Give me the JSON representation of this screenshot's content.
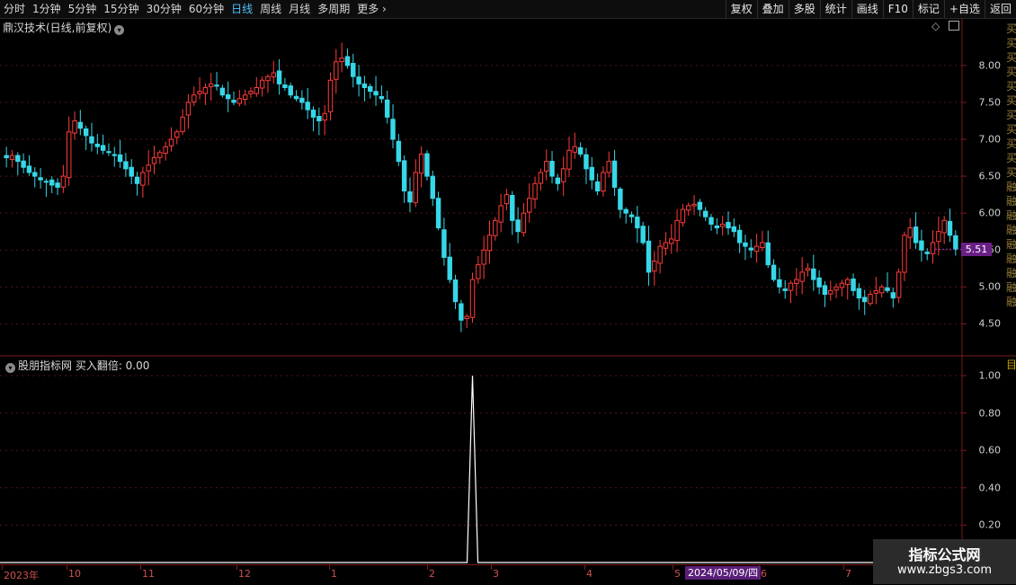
{
  "toolbar": {
    "periods": [
      {
        "label": "分时",
        "active": false
      },
      {
        "label": "1分钟",
        "active": false
      },
      {
        "label": "5分钟",
        "active": false
      },
      {
        "label": "15分钟",
        "active": false
      },
      {
        "label": "30分钟",
        "active": false
      },
      {
        "label": "60分钟",
        "active": false
      },
      {
        "label": "日线",
        "active": true
      },
      {
        "label": "周线",
        "active": false
      },
      {
        "label": "月线",
        "active": false
      },
      {
        "label": "多周期",
        "active": false
      }
    ],
    "more_label": "更多",
    "right_buttons": [
      "复权",
      "叠加",
      "多股",
      "统计",
      "画线",
      "F10",
      "标记",
      "+自选",
      "返回"
    ]
  },
  "main_panel": {
    "title": "鼎汉技术(日线,前复权)",
    "price_axis": [
      "8.00",
      "7.50",
      "7.00",
      "6.50",
      "6.00",
      "5.50",
      "5.00",
      "4.50"
    ],
    "current_price": "5.51"
  },
  "indicator_panel": {
    "title": "股朋指标网 买入翻倍: 0.00",
    "axis": [
      "1.00",
      "0.80",
      "0.60",
      "0.40",
      "0.20"
    ],
    "side_label": "目"
  },
  "side_strip_text": "买买买买买买买买买买买融融融融融融融融融",
  "date_axis": {
    "labels": [
      "2023年",
      "10",
      "11",
      "12",
      "1",
      "2",
      "3",
      "4",
      "5",
      "6",
      "7"
    ],
    "cursor_date": "2024/05/09/四"
  },
  "watermark": {
    "title": "指标公式网",
    "url": "www.zbgs3.com"
  },
  "chart_data": [
    {
      "type": "candlestick",
      "title": "鼎汉技术(日线,前复权)",
      "ylim": [
        4.2,
        8.4
      ],
      "up_color": "#ff3b3b",
      "down_color": "#36d8e8",
      "series": [
        {
          "values": [
            6.75,
            6.78,
            6.7,
            6.62,
            6.55,
            6.5,
            6.45,
            6.42,
            6.38,
            6.35,
            6.5,
            7.1,
            7.25,
            7.15,
            7.05,
            6.95,
            6.9,
            6.85,
            6.82,
            6.78,
            6.7,
            6.6,
            6.5,
            6.4,
            6.55,
            6.65,
            6.75,
            6.82,
            6.9,
            7.0,
            7.1,
            7.3,
            7.5,
            7.6,
            7.65,
            7.7,
            7.75,
            7.72,
            7.6,
            7.55,
            7.5,
            7.55,
            7.6,
            7.65,
            7.7,
            7.8,
            7.85,
            7.9,
            7.75,
            7.7,
            7.6,
            7.55,
            7.5,
            7.4,
            7.3,
            7.25,
            7.35,
            7.8,
            8.05,
            8.1,
            8.0,
            7.85,
            7.75,
            7.7,
            7.65,
            7.6,
            7.55,
            7.3,
            7.0,
            6.7,
            6.3,
            6.15,
            6.55,
            6.8,
            6.5,
            6.2,
            5.8,
            5.4,
            5.1,
            4.8,
            4.55,
            4.6,
            5.1,
            5.3,
            5.5,
            5.7,
            5.9,
            6.1,
            6.25,
            5.9,
            5.75,
            6.0,
            6.2,
            6.4,
            6.55,
            6.7,
            6.5,
            6.4,
            6.6,
            6.85,
            6.9,
            6.8,
            6.6,
            6.45,
            6.3,
            6.55,
            6.7,
            6.35,
            6.05,
            6.0,
            5.95,
            5.8,
            5.6,
            5.2,
            5.35,
            5.55,
            5.6,
            5.65,
            5.9,
            6.05,
            6.1,
            6.12,
            6.05,
            5.95,
            5.85,
            5.8,
            5.85,
            5.8,
            5.75,
            5.6,
            5.55,
            5.5,
            5.55,
            5.6,
            5.3,
            5.1,
            5.0,
            4.95,
            5.05,
            5.1,
            5.2,
            5.25,
            5.1,
            5.0,
            4.9,
            4.95,
            5.0,
            5.05,
            5.1,
            4.95,
            4.85,
            4.8,
            4.9,
            4.95,
            5.0,
            4.95,
            4.85,
            5.2,
            5.7,
            5.8,
            5.6,
            5.5,
            5.45,
            5.6,
            5.75,
            5.9,
            5.7,
            5.51
          ]
        }
      ]
    },
    {
      "type": "line",
      "title": "股朋指标网 买入翻倍",
      "ylim": [
        0,
        1.0
      ],
      "spike_index": 82,
      "series": [
        {
          "name": "买入翻倍",
          "values_note": "",
          "peak": 1.0
        }
      ]
    }
  ]
}
